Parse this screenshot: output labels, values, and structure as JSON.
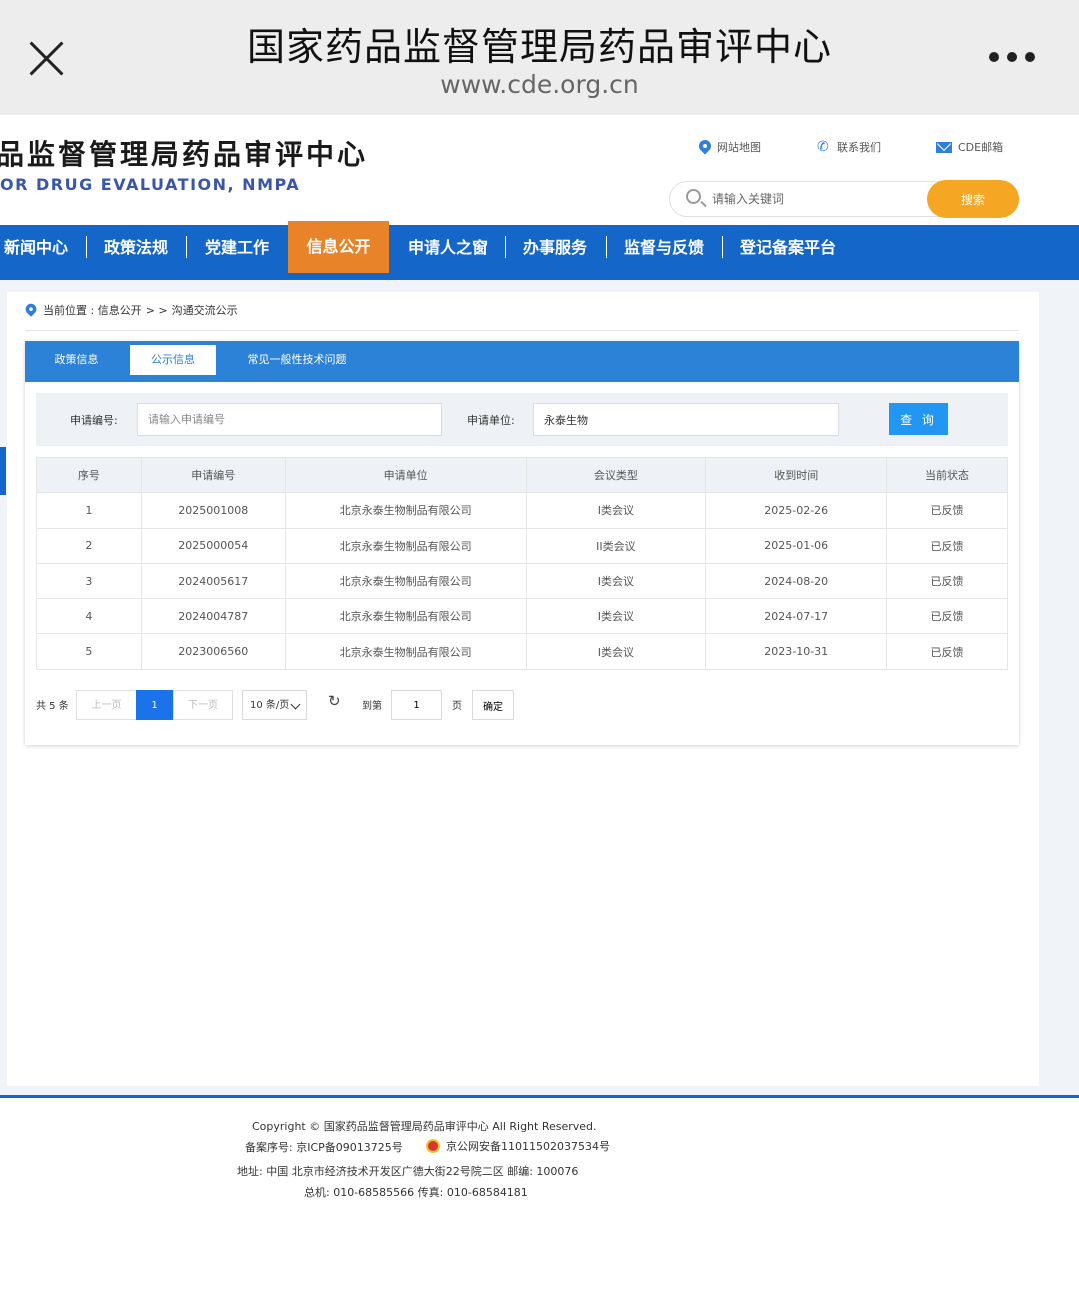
{
  "browser": {
    "title": "国家药品监督管理局药品审评中心",
    "url": "www.cde.org.cn"
  },
  "header": {
    "logo_cn": "品监督管理局药品审评中心",
    "logo_en": "OR DRUG EVALUATION, NMPA",
    "links": [
      "网站地图",
      "联系我们",
      "CDE邮箱"
    ],
    "search_placeholder": "请输入关键词",
    "search_button": "搜索"
  },
  "nav": {
    "items": [
      "新闻中心",
      "政策法规",
      "党建工作",
      "信息公开",
      "申请人之窗",
      "办事服务",
      "监督与反馈",
      "登记备案平台"
    ],
    "active": "信息公开"
  },
  "breadcrumb": {
    "prefix": "当前位置 : 信息公开",
    "separator": "> >",
    "current": "沟通交流公示"
  },
  "tabs": [
    "政策信息",
    "公示信息",
    "常见一般性技术问题"
  ],
  "filter": {
    "app_no_label": "申请编号:",
    "app_no_placeholder": "请输入申请编号",
    "app_no_value": "",
    "unit_label": "申请单位:",
    "unit_value": "永泰生物",
    "query_button": "查 询"
  },
  "table": {
    "headers": [
      "序号",
      "申请编号",
      "申请单位",
      "会议类型",
      "收到时间",
      "当前状态"
    ],
    "rows": [
      [
        "1",
        "2025001008",
        "北京永泰生物制品有限公司",
        "I类会议",
        "2025-02-26",
        "已反馈"
      ],
      [
        "2",
        "2025000054",
        "北京永泰生物制品有限公司",
        "II类会议",
        "2025-01-06",
        "已反馈"
      ],
      [
        "3",
        "2024005617",
        "北京永泰生物制品有限公司",
        "I类会议",
        "2024-08-20",
        "已反馈"
      ],
      [
        "4",
        "2024004787",
        "北京永泰生物制品有限公司",
        "I类会议",
        "2024-07-17",
        "已反馈"
      ],
      [
        "5",
        "2023006560",
        "北京永泰生物制品有限公司",
        "I类会议",
        "2023-10-31",
        "已反馈"
      ]
    ]
  },
  "pager": {
    "total": "共 5 条",
    "prev": "上一页",
    "current": "1",
    "next": "下一页",
    "page_size": "10 条/页",
    "goto_label": "到第",
    "goto_value": "1",
    "page_unit": "页",
    "confirm": "确定"
  },
  "footer": {
    "copyright": "Copyright © 国家药品监督管理局药品审评中心   All Right Reserved.",
    "icp": "备案序号:  京ICP备09013725号",
    "police": "京公网安备11011502037534号",
    "address": "地址:  中国 北京市经济技术开发区广德大街22号院二区      邮编:  100076",
    "phone": "总机:  010-68585566      传真:  010-68584181"
  }
}
